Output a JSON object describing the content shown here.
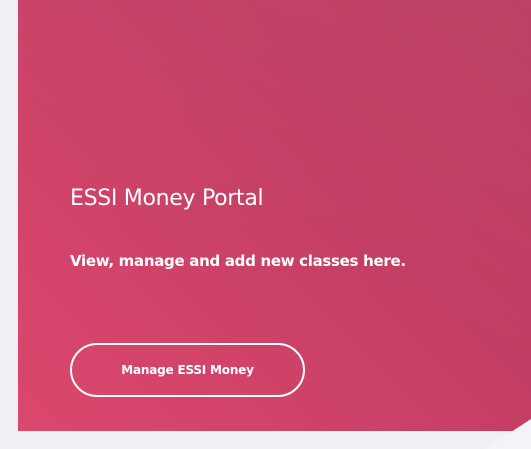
{
  "card": {
    "title": "ESSI Money Portal",
    "subtitle": "View, manage and add new classes here.",
    "button_label": "Manage ESSI Money"
  },
  "colors": {
    "page_background": "#efeff5",
    "card_gradient_start": "#db476d",
    "card_gradient_end": "#b83a5e",
    "text": "#ffffff"
  }
}
